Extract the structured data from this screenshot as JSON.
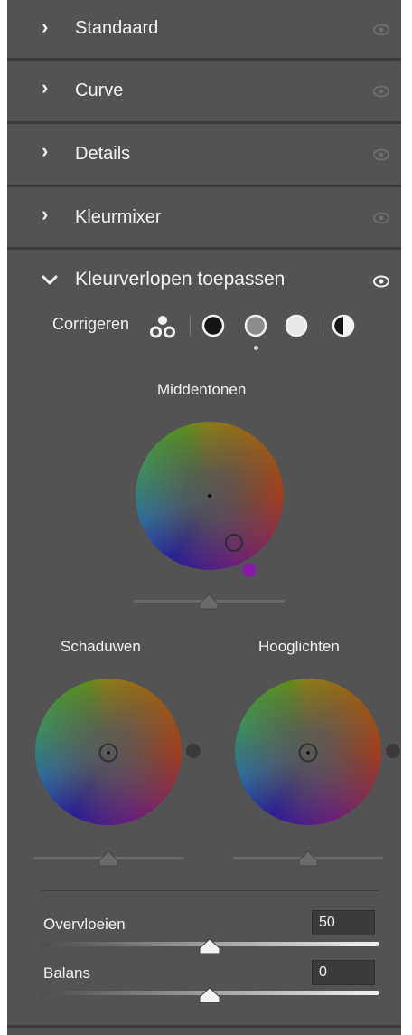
{
  "sections": [
    {
      "label": "Standaard",
      "expanded": false
    },
    {
      "label": "Curve",
      "expanded": false
    },
    {
      "label": "Details",
      "expanded": false
    },
    {
      "label": "Kleurmixer",
      "expanded": false
    },
    {
      "label": "Kleurverlopen toepassen",
      "expanded": true
    }
  ],
  "color_grading": {
    "adjust_label": "Corrigeren",
    "adjust_modes": [
      "three-way-icon",
      "shadows-icon",
      "midtones-icon",
      "highlights-icon",
      "global-icon"
    ],
    "selected_mode": "midtones-icon",
    "midtones_label": "Middentonen",
    "shadows_label": "Schaduwen",
    "highlights_label": "Hooglichten",
    "blending_label": "Overvloeien",
    "blending_value": "50",
    "balance_label": "Balans",
    "balance_value": "0",
    "accent_color": "#8a1aa6"
  }
}
